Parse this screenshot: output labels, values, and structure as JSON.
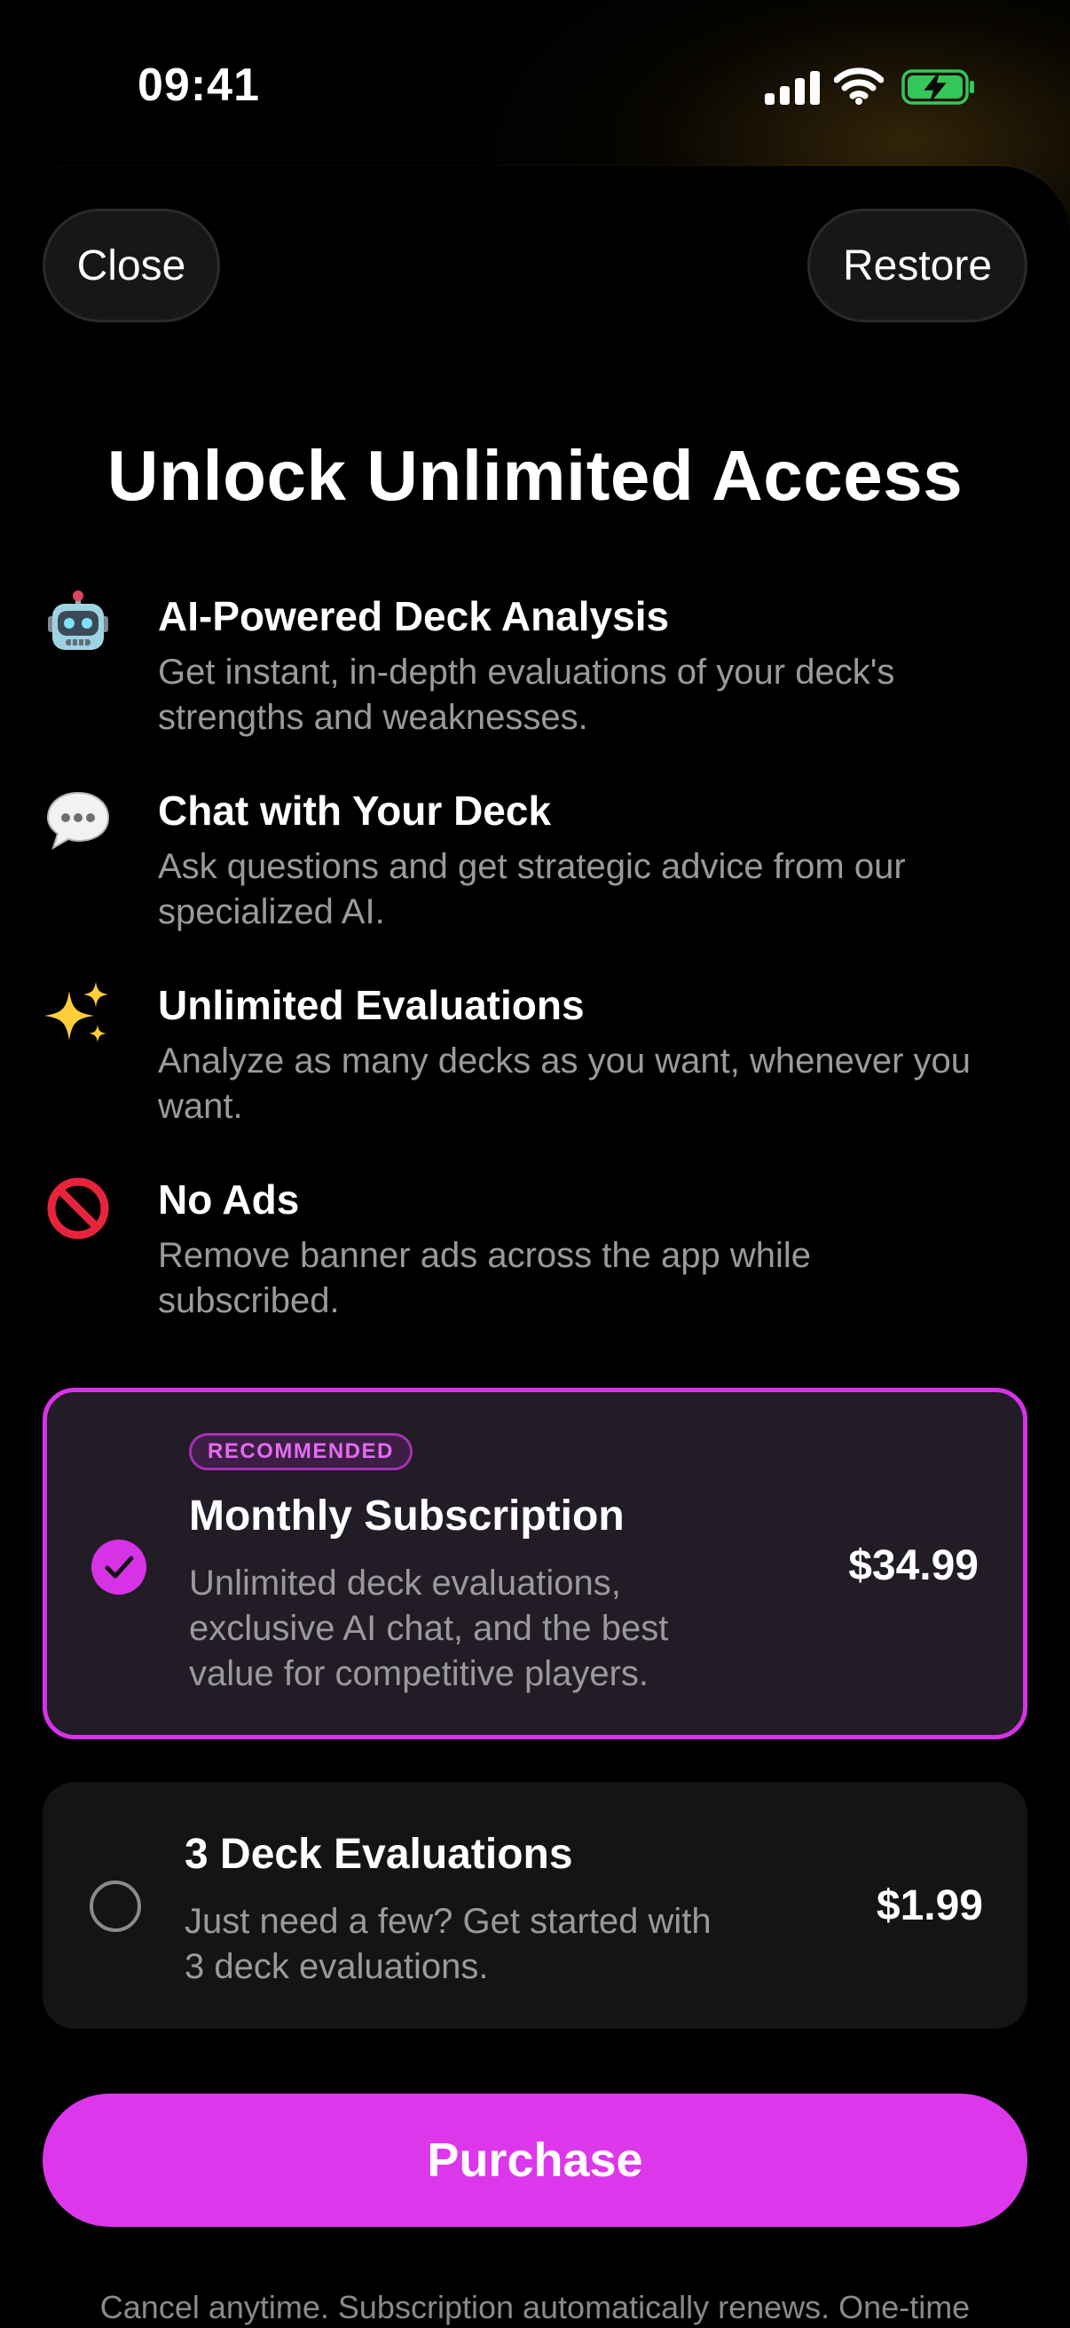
{
  "status_bar": {
    "time": "09:41",
    "battery_color": "#34c759"
  },
  "header": {
    "close_label": "Close",
    "restore_label": "Restore"
  },
  "title": "Unlock Unlimited Access",
  "features": [
    {
      "icon": "robot-icon",
      "title": "AI-Powered Deck Analysis",
      "description": "Get instant, in-depth evaluations of your deck's strengths and weaknesses."
    },
    {
      "icon": "speech-bubble-icon",
      "title": "Chat with Your Deck",
      "description": "Ask questions and get strategic advice from our specialized AI."
    },
    {
      "icon": "sparkles-icon",
      "title": "Unlimited Evaluations",
      "description": "Analyze as many decks as you want, whenever you want."
    },
    {
      "icon": "no-entry-icon",
      "title": "No Ads",
      "description": "Remove banner ads across the app while subscribed."
    }
  ],
  "plans": [
    {
      "badge": "RECOMMENDED",
      "title": "Monthly Subscription",
      "description": "Unlimited deck evaluations, exclusive AI chat, and the best value for competitive players.",
      "price": "$34.99",
      "selected": true
    },
    {
      "title": "3 Deck Evaluations",
      "description": "Just need a few? Get started with 3 deck evaluations.",
      "price": "$1.99",
      "selected": false
    }
  ],
  "purchase_label": "Purchase",
  "footer_note": "Cancel anytime. Subscription automatically renews. One-time",
  "colors": {
    "accent": "#dd37ec",
    "selected_card_bg": "#221c26",
    "card_bg": "#141414",
    "muted_text": "#9a9a9a"
  }
}
